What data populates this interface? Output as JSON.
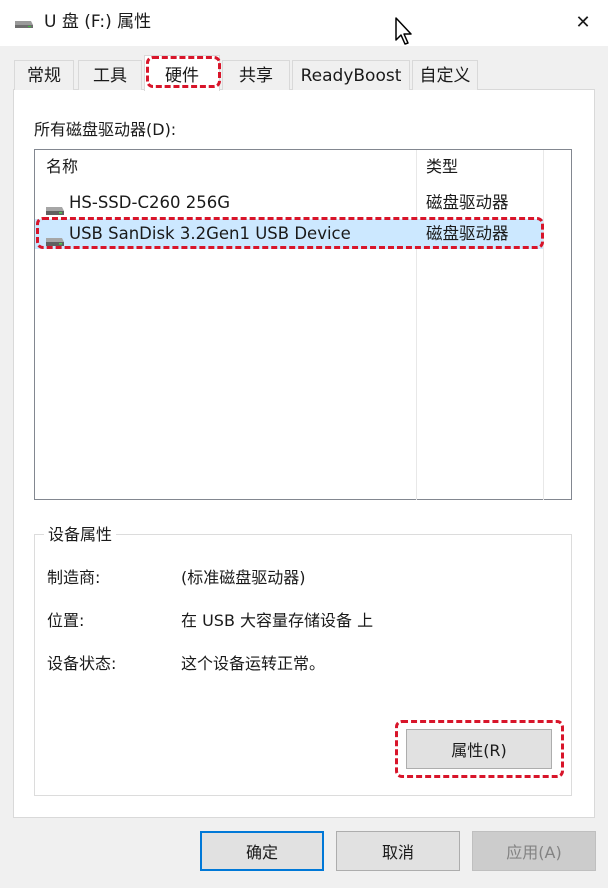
{
  "window": {
    "title": "U 盘 (F:) 属性",
    "drive_icon": "usb-drive-icon",
    "close_glyph": "✕"
  },
  "tabs": [
    {
      "label": "常规"
    },
    {
      "label": "工具"
    },
    {
      "label": "硬件",
      "active": true
    },
    {
      "label": "共享"
    },
    {
      "label": "ReadyBoost"
    },
    {
      "label": "自定义"
    }
  ],
  "drives_section": {
    "label": "所有磁盘驱动器(D):",
    "columns": [
      "名称",
      "类型"
    ],
    "rows": [
      {
        "name": "HS-SSD-C260 256G",
        "type": "磁盘驱动器",
        "selected": false
      },
      {
        "name": "USB  SanDisk 3.2Gen1 USB Device",
        "type": "磁盘驱动器",
        "selected": true
      }
    ]
  },
  "device_properties": {
    "legend": "设备属性",
    "fields": [
      {
        "label": "制造商:",
        "value": "(标准磁盘驱动器)"
      },
      {
        "label": "位置:",
        "value": "在 USB 大容量存储设备 上"
      },
      {
        "label": "设备状态:",
        "value": "这个设备运转正常。"
      }
    ],
    "properties_button": "属性(R)"
  },
  "footer": {
    "ok": "确定",
    "cancel": "取消",
    "apply": "应用(A)"
  },
  "colors": {
    "highlight": "#d8152a",
    "selection": "#cce8ff",
    "default_button_border": "#0078d7"
  }
}
